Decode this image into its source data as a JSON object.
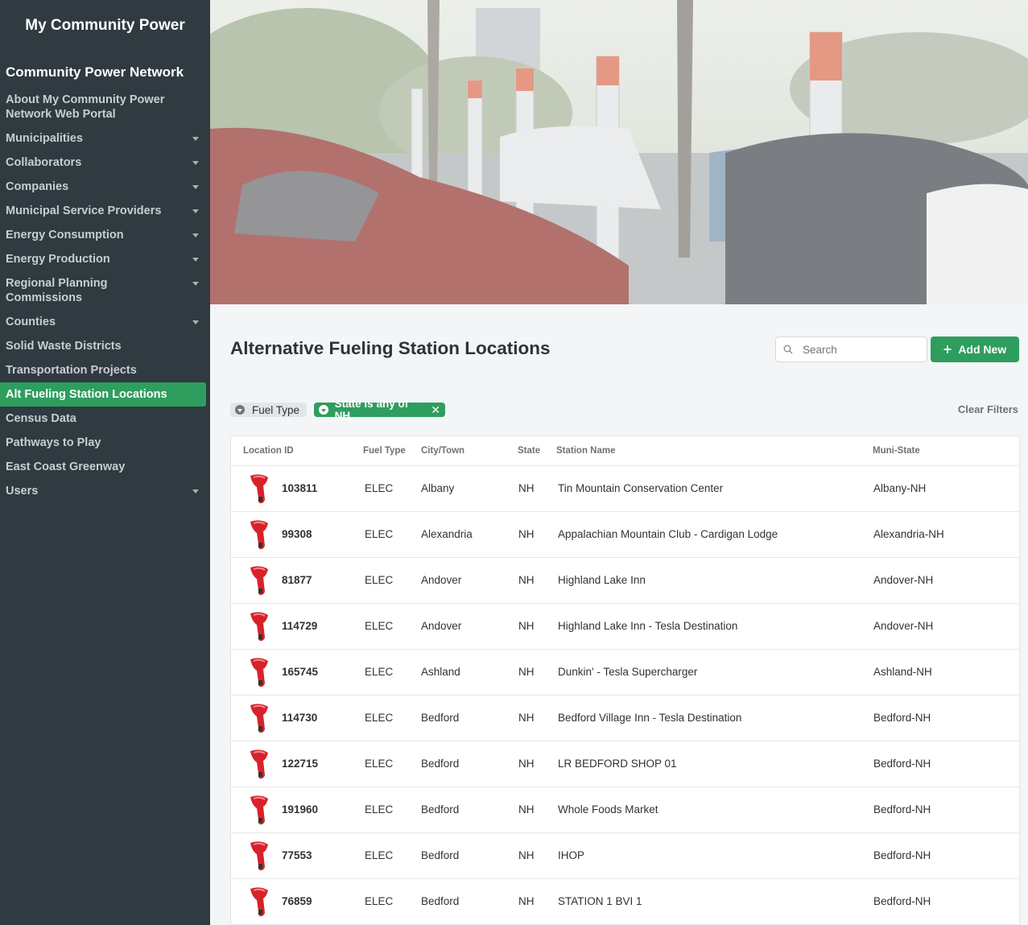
{
  "sidebar": {
    "brand": "My Community Power",
    "section_title": "Community Power Network",
    "items": [
      {
        "label": "About My Community Power Network Web Portal",
        "caret": false,
        "active": false
      },
      {
        "label": "Municipalities",
        "caret": true,
        "active": false
      },
      {
        "label": "Collaborators",
        "caret": true,
        "active": false
      },
      {
        "label": "Companies",
        "caret": true,
        "active": false
      },
      {
        "label": "Municipal Service Providers",
        "caret": true,
        "active": false
      },
      {
        "label": "Energy Consumption",
        "caret": true,
        "active": false
      },
      {
        "label": "Energy Production",
        "caret": true,
        "active": false
      },
      {
        "label": "Regional Planning Commissions",
        "caret": true,
        "active": false
      },
      {
        "label": "Counties",
        "caret": true,
        "active": false
      },
      {
        "label": "Solid Waste Districts",
        "caret": false,
        "active": false
      },
      {
        "label": "Transportation Projects",
        "caret": false,
        "active": false
      },
      {
        "label": "Alt Fueling Station Locations",
        "caret": false,
        "active": true
      },
      {
        "label": "Census Data",
        "caret": false,
        "active": false
      },
      {
        "label": "Pathways to Play",
        "caret": false,
        "active": false
      },
      {
        "label": "East Coast Greenway",
        "caret": false,
        "active": false
      },
      {
        "label": "Users",
        "caret": true,
        "active": false
      }
    ]
  },
  "header": {
    "title": "Alternative Fueling Station Locations",
    "search_placeholder": "Search",
    "add_label": "Add New"
  },
  "filters": {
    "fuel_type": "Fuel Type",
    "state": "State is any of NH",
    "clear": "Clear Filters"
  },
  "table": {
    "columns": [
      "Location ID",
      "Fuel Type",
      "City/Town",
      "State",
      "Station Name",
      "Muni-State"
    ],
    "rows": [
      {
        "id": "103811",
        "fuel": "ELEC",
        "city": "Albany",
        "state": "NH",
        "name": "Tin Mountain Conservation Center",
        "muni": "Albany-NH"
      },
      {
        "id": "99308",
        "fuel": "ELEC",
        "city": "Alexandria",
        "state": "NH",
        "name": "Appalachian Mountain Club - Cardigan Lodge",
        "muni": "Alexandria-NH"
      },
      {
        "id": "81877",
        "fuel": "ELEC",
        "city": "Andover",
        "state": "NH",
        "name": "Highland Lake Inn",
        "muni": "Andover-NH"
      },
      {
        "id": "114729",
        "fuel": "ELEC",
        "city": "Andover",
        "state": "NH",
        "name": "Highland Lake Inn - Tesla Destination",
        "muni": "Andover-NH"
      },
      {
        "id": "165745",
        "fuel": "ELEC",
        "city": "Ashland",
        "state": "NH",
        "name": "Dunkin' - Tesla Supercharger",
        "muni": "Ashland-NH"
      },
      {
        "id": "114730",
        "fuel": "ELEC",
        "city": "Bedford",
        "state": "NH",
        "name": "Bedford Village Inn - Tesla Destination",
        "muni": "Bedford-NH"
      },
      {
        "id": "122715",
        "fuel": "ELEC",
        "city": "Bedford",
        "state": "NH",
        "name": "LR BEDFORD SHOP 01",
        "muni": "Bedford-NH"
      },
      {
        "id": "191960",
        "fuel": "ELEC",
        "city": "Bedford",
        "state": "NH",
        "name": "Whole Foods Market",
        "muni": "Bedford-NH"
      },
      {
        "id": "77553",
        "fuel": "ELEC",
        "city": "Bedford",
        "state": "NH",
        "name": "IHOP",
        "muni": "Bedford-NH"
      },
      {
        "id": "76859",
        "fuel": "ELEC",
        "city": "Bedford",
        "state": "NH",
        "name": "STATION 1 BVI 1",
        "muni": "Bedford-NH"
      }
    ]
  },
  "colors": {
    "sidebar_bg": "#303a41",
    "accent_green": "#2e9e5e",
    "pump_red": "#d8222a"
  }
}
